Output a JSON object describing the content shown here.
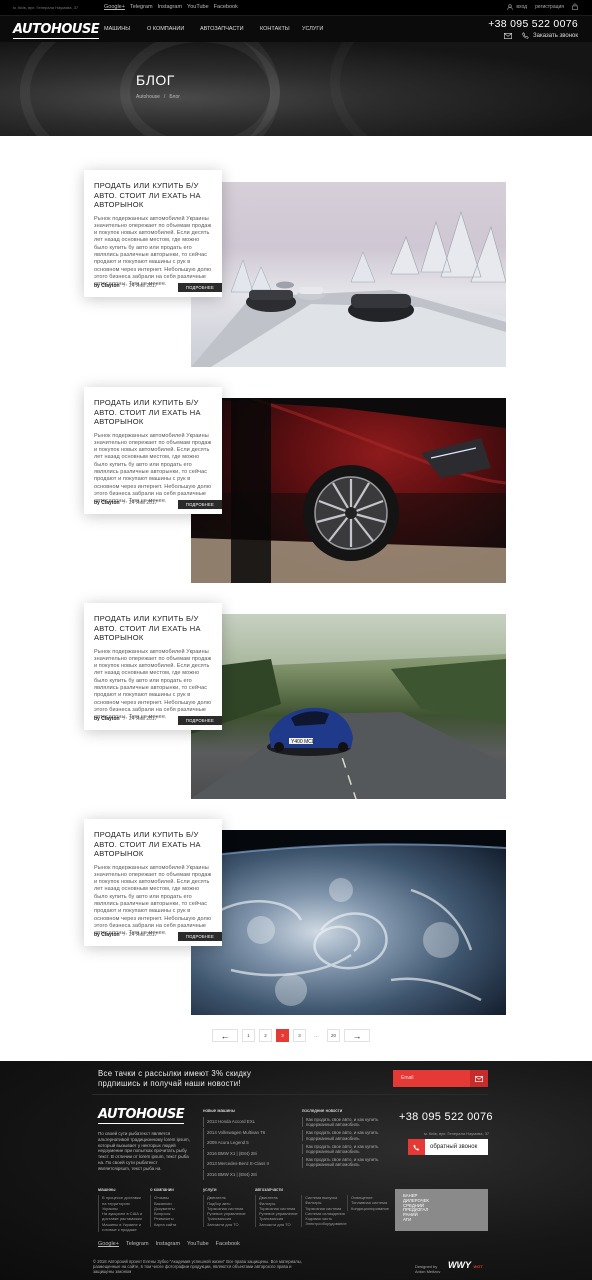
{
  "topbar": {
    "address": "м. Київ, вул. Генерала Наумова, 37",
    "social": [
      "Google+",
      "Telegram",
      "Instagram",
      "YouTube",
      "Facebook"
    ],
    "login": "вход",
    "register": "регистрация"
  },
  "header": {
    "logo": "AUTOHOUSE",
    "nav": [
      "машины",
      "о компании",
      "автозапчасти",
      "контакты",
      "услуги"
    ],
    "phone": "+38 095 522 0076",
    "callback": "Заказать звонок"
  },
  "hero": {
    "title": "БЛОГ",
    "breadcrumb_home": "Autohouse",
    "breadcrumb_sep": "/",
    "breadcrumb_current": "Блог"
  },
  "posts": [
    {
      "title": "ПРОДАТЬ ИЛИ КУПИТЬ Б/У АВТО. СТОИТ ЛИ ЕХАТЬ НА АВТОРЫНОК",
      "text": "Рынок подержанных автомобилей Украины значительно опережает по объемам продаж и покупок новых автомобилей. Если десять лет назад основным местом, где можно было купить бу авто или продать его являлись различные авторынки, то сейчас продают и покупают машины с рук в основном через интернет. Небольшую долю этого бизнеса забрали на себя различные автосалоны, Тем не менее.",
      "author": "by Clayton",
      "sep": "/",
      "date": "24 Янв 2017",
      "more": "ПОДРОБНЕЕ",
      "image": "snow-road-cars"
    },
    {
      "title": "ПРОДАТЬ ИЛИ КУПИТЬ Б/У АВТО. СТОИТ ЛИ ЕХАТЬ НА АВТОРЫНОК",
      "text": "Рынок подержанных автомобилей Украины значительно опережает по объемам продаж и покупок новых автомобилей. Если десять лет назад основным местом, где можно было купить бу авто или продать его являлись различные авторынки, то сейчас продают и покупают машины с рук в основном через интернет. Небольшую долю этого бизнеса забрали на себя различные автосалоны, Тем не менее.",
      "author": "by Clayton",
      "sep": "/",
      "date": "24 Янв 2017",
      "more": "ПОДРОБНЕЕ",
      "image": "red-car-wheel"
    },
    {
      "title": "ПРОДАТЬ ИЛИ КУПИТЬ Б/У АВТО. СТОИТ ЛИ ЕХАТЬ НА АВТОРЫНОК",
      "text": "Рынок подержанных автомобилей Украины значительно опережает по объемам продаж и покупок новых автомобилей. Если десять лет назад основным местом, где можно было купить бу авто или продать его являлись различные авторынки, то сейчас продают и покупают машины с рук в основном через интернет. Небольшую долю этого бизнеса забрали на себя различные автосалоны, Тем не менее.",
      "author": "by Clayton",
      "sep": "/",
      "date": "24 Янв 2017",
      "more": "ПОДРОБНЕЕ",
      "image": "blue-sports-car",
      "plate": "Y400 MCL"
    },
    {
      "title": "ПРОДАТЬ ИЛИ КУПИТЬ Б/У АВТО. СТОИТ ЛИ ЕХАТЬ НА АВТОРЫНОК",
      "text": "Рынок подержанных автомобилей Украины значительно опережает по объемам продаж и покупок новых автомобилей. Если десять лет назад основным местом, где можно было купить бу авто или продать его являлись различные авторынки, то сейчас продают и покупают машины с рук в основном через интернет. Небольшую долю этого бизнеса забрали на себя различные автосалоны, Тем не менее.",
      "author": "by Clayton",
      "sep": "/",
      "date": "24 Янв 2017",
      "more": "ПОДРОБНЕЕ",
      "image": "earth-from-space"
    }
  ],
  "pager": {
    "prev": "←",
    "pages": [
      "1",
      "2",
      "3",
      "3"
    ],
    "dots": "...",
    "last": "20",
    "next": "→",
    "active_index": 2
  },
  "footer": {
    "subscribe": "Все тачки с рассылки имеют 3% скидку\nпрдпишись и получай наши новости!",
    "email_placeholder": "Email",
    "logo": "AUTOHOUSE",
    "description": "По своей сути рыбатекст является альтернативой традиционному lorem ipsum, который вызывает у некторых людей недоумение при попытках прочитать рыбу текст. В отличии от lorem ipsum, текст рыба на. По своей сути рыбатекст являетсяipsum, текст рыба на.",
    "new_cars_title": "новые машины",
    "new_cars": [
      "2013 Honda Accord EXL",
      "2014 Volkswagen Multivan T6",
      "2009 Acura Legend 5",
      "2016 BMW X1 | (E84) 28i",
      "2013 Mercedes-Benz E-Class II",
      "2016 BMW X1 | (E84) 28i"
    ],
    "news_title": "последние новости",
    "news": [
      "Как продать свое авто, и как купить подержанный автомобиль",
      "Как продать свое авто, и как купить подержанный автомобиль",
      "Как продать свое авто, и как купить подержанный автомобиль",
      "Как продать свое авто, и как купить подержанный автомобиль"
    ],
    "phone": "+38 095 522 0076",
    "address": "м. Київ, вул. Генерала Наумова, 37",
    "callback": "обратный звонок",
    "menu": {
      "cars": {
        "title": "машины",
        "items": [
          "В процессе доставки на территорию Украины",
          "На аукционе в США и доставке растаможки",
          "Машины в Украине и готовые к продаже"
        ]
      },
      "about": {
        "title": "о компании",
        "items": [
          "Отзывы",
          "Вакансии",
          "Документы",
          "Вопросы",
          "Реквизиты",
          "Карта сайта"
        ]
      },
      "services": {
        "title": "услуги",
        "items": [
          "Двигатель",
          "Подбор авто",
          "Тормозная система",
          "Рулевое управление",
          "Трансмиссия",
          "Запчасти для ТО"
        ]
      },
      "parts": {
        "title": "автозапчасти",
        "items": [
          "Двигатель",
          "Фильтры",
          "Тормозная система",
          "Рулевое управление",
          "Трансмиссия",
          "Запчасти для ТО"
        ]
      },
      "parts2": {
        "items": [
          "Система выпуска",
          "Фильтры",
          "Тормозная система",
          "Система охлаждения",
          "Ходовая часть",
          "Электрооборудование"
        ]
      },
      "parts3": {
        "items": [
          "Освещение",
          "Топливная система",
          "Кондиционирование"
        ]
      }
    },
    "banner": "БАНЕР\nДИЛЕРОЧЕК\nСРЕДНИЙ\nПРЕДИЗГАЛ\nРАНИЙ\nАТИ",
    "social": [
      "Google+",
      "Telegram",
      "Instagram",
      "YouTube",
      "Facebook"
    ],
    "copyright": "© 2018 Авторский проект Елены Зубко \"Академия успешной жизни\" Все права защищены. Все материалы, размещенные на сайте, в том числе фотографии продукции, являются объектами авторского права и защищены законом",
    "designed_label": "Designed by",
    "designer": "Anton Meltzov",
    "studio": "WWY",
    "studio_sub": "WOT"
  },
  "colors": {
    "accent": "#e53935",
    "dark": "#0b0b0b",
    "card_bg": "#ffffff"
  }
}
